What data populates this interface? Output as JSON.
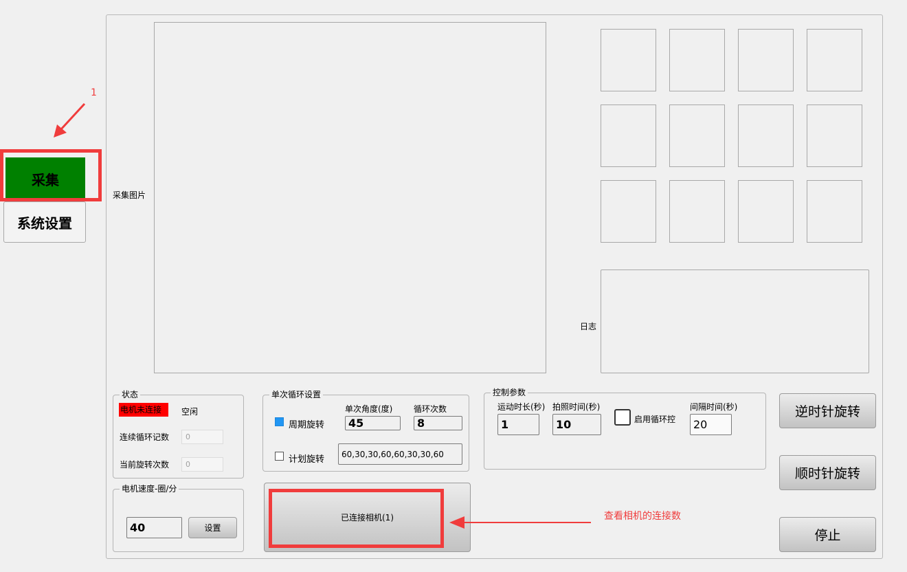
{
  "sidebar": {
    "collect_label": "采集",
    "settings_label": "系统设置"
  },
  "annotations": {
    "step_number": "1",
    "camera_note": "查看相机的连接数"
  },
  "capture": {
    "image_label": "采集图片",
    "log_label": "日志"
  },
  "status": {
    "title": "状态",
    "motor_status": "电机未连接",
    "state_text": "空闲",
    "loop_count_label": "连续循环记数",
    "loop_count_value": "0",
    "rotate_count_label": "当前旋转次数",
    "rotate_count_value": "0"
  },
  "motor_speed": {
    "title": "电机速度-圈/分",
    "value": "40",
    "set_label": "设置"
  },
  "single_loop": {
    "title": "单次循环设置",
    "angle_label": "单次角度(度)",
    "count_label": "循环次数",
    "periodic_label": "周期旋转",
    "periodic_checked": true,
    "angle_value": "45",
    "count_value": "8",
    "plan_label": "计划旋转",
    "plan_checked": false,
    "plan_value": "60,30,30,60,60,30,30,60"
  },
  "camera": {
    "connected_label": "已连接相机(1)"
  },
  "control": {
    "title": "控制参数",
    "duration_label": "运动时长(秒)",
    "duration_value": "1",
    "photo_label": "拍照时间(秒)",
    "photo_value": "10",
    "loop_ctrl_label": "启用循环控",
    "loop_ctrl_checked": false,
    "interval_label": "间隔时间(秒)",
    "interval_value": "20"
  },
  "actions": {
    "ccw_label": "逆时针旋转",
    "cw_label": "顺时针旋转",
    "stop_label": "停止"
  },
  "colors": {
    "accent_red": "#f03c3c",
    "active_green": "#008000",
    "status_red": "#ff0000",
    "check_blue": "#2196f3"
  }
}
